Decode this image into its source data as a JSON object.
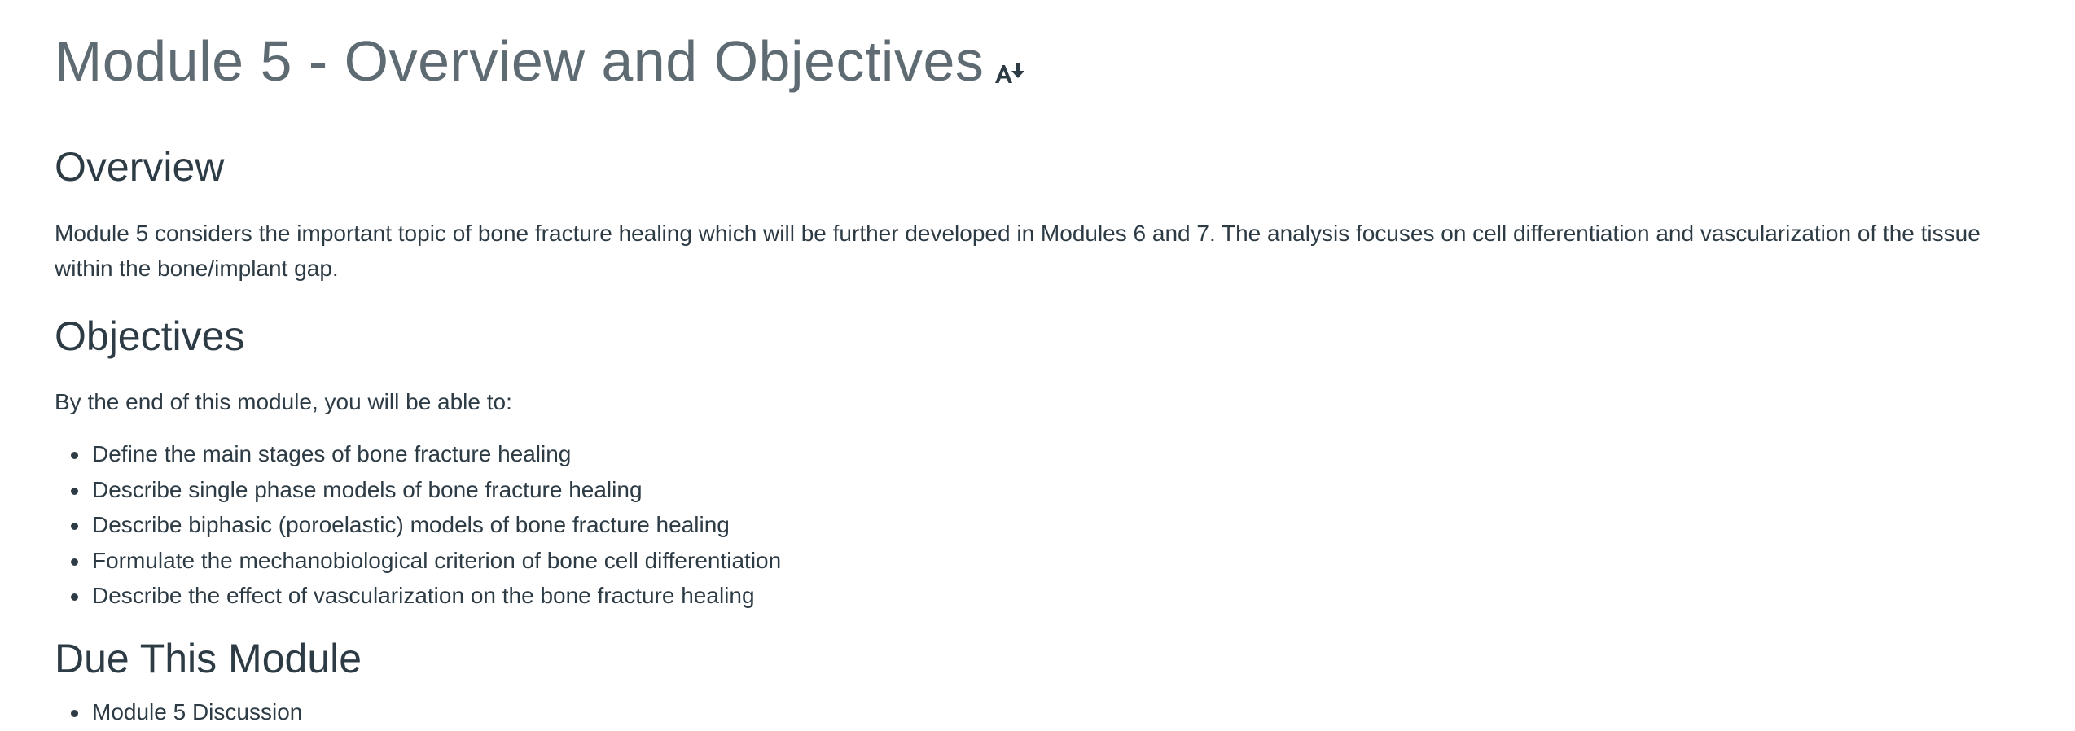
{
  "page": {
    "title": "Module 5 - Overview and Objectives",
    "title_icon": "accessibility-alternative-formats-icon"
  },
  "overview": {
    "heading": "Overview",
    "text": "Module 5 considers the important topic of bone fracture healing which will be further developed in Modules 6 and 7. The analysis focuses on cell differentiation and vascularization of the tissue within the bone/implant gap."
  },
  "objectives": {
    "heading": "Objectives",
    "intro": "By the end of this module, you will be able to:",
    "items": [
      "Define the main stages of bone fracture healing",
      "Describe single phase models of bone fracture healing",
      "Describe biphasic (poroelastic) models of bone fracture healing",
      "Formulate the mechanobiological criterion of bone cell differentiation",
      "Describe the effect of vascularization on the bone fracture healing"
    ]
  },
  "due": {
    "heading": "Due This Module",
    "items": [
      "Module 5 Discussion"
    ]
  },
  "colors": {
    "title": "#5f6b73",
    "text": "#2d3b45",
    "background": "#ffffff"
  }
}
